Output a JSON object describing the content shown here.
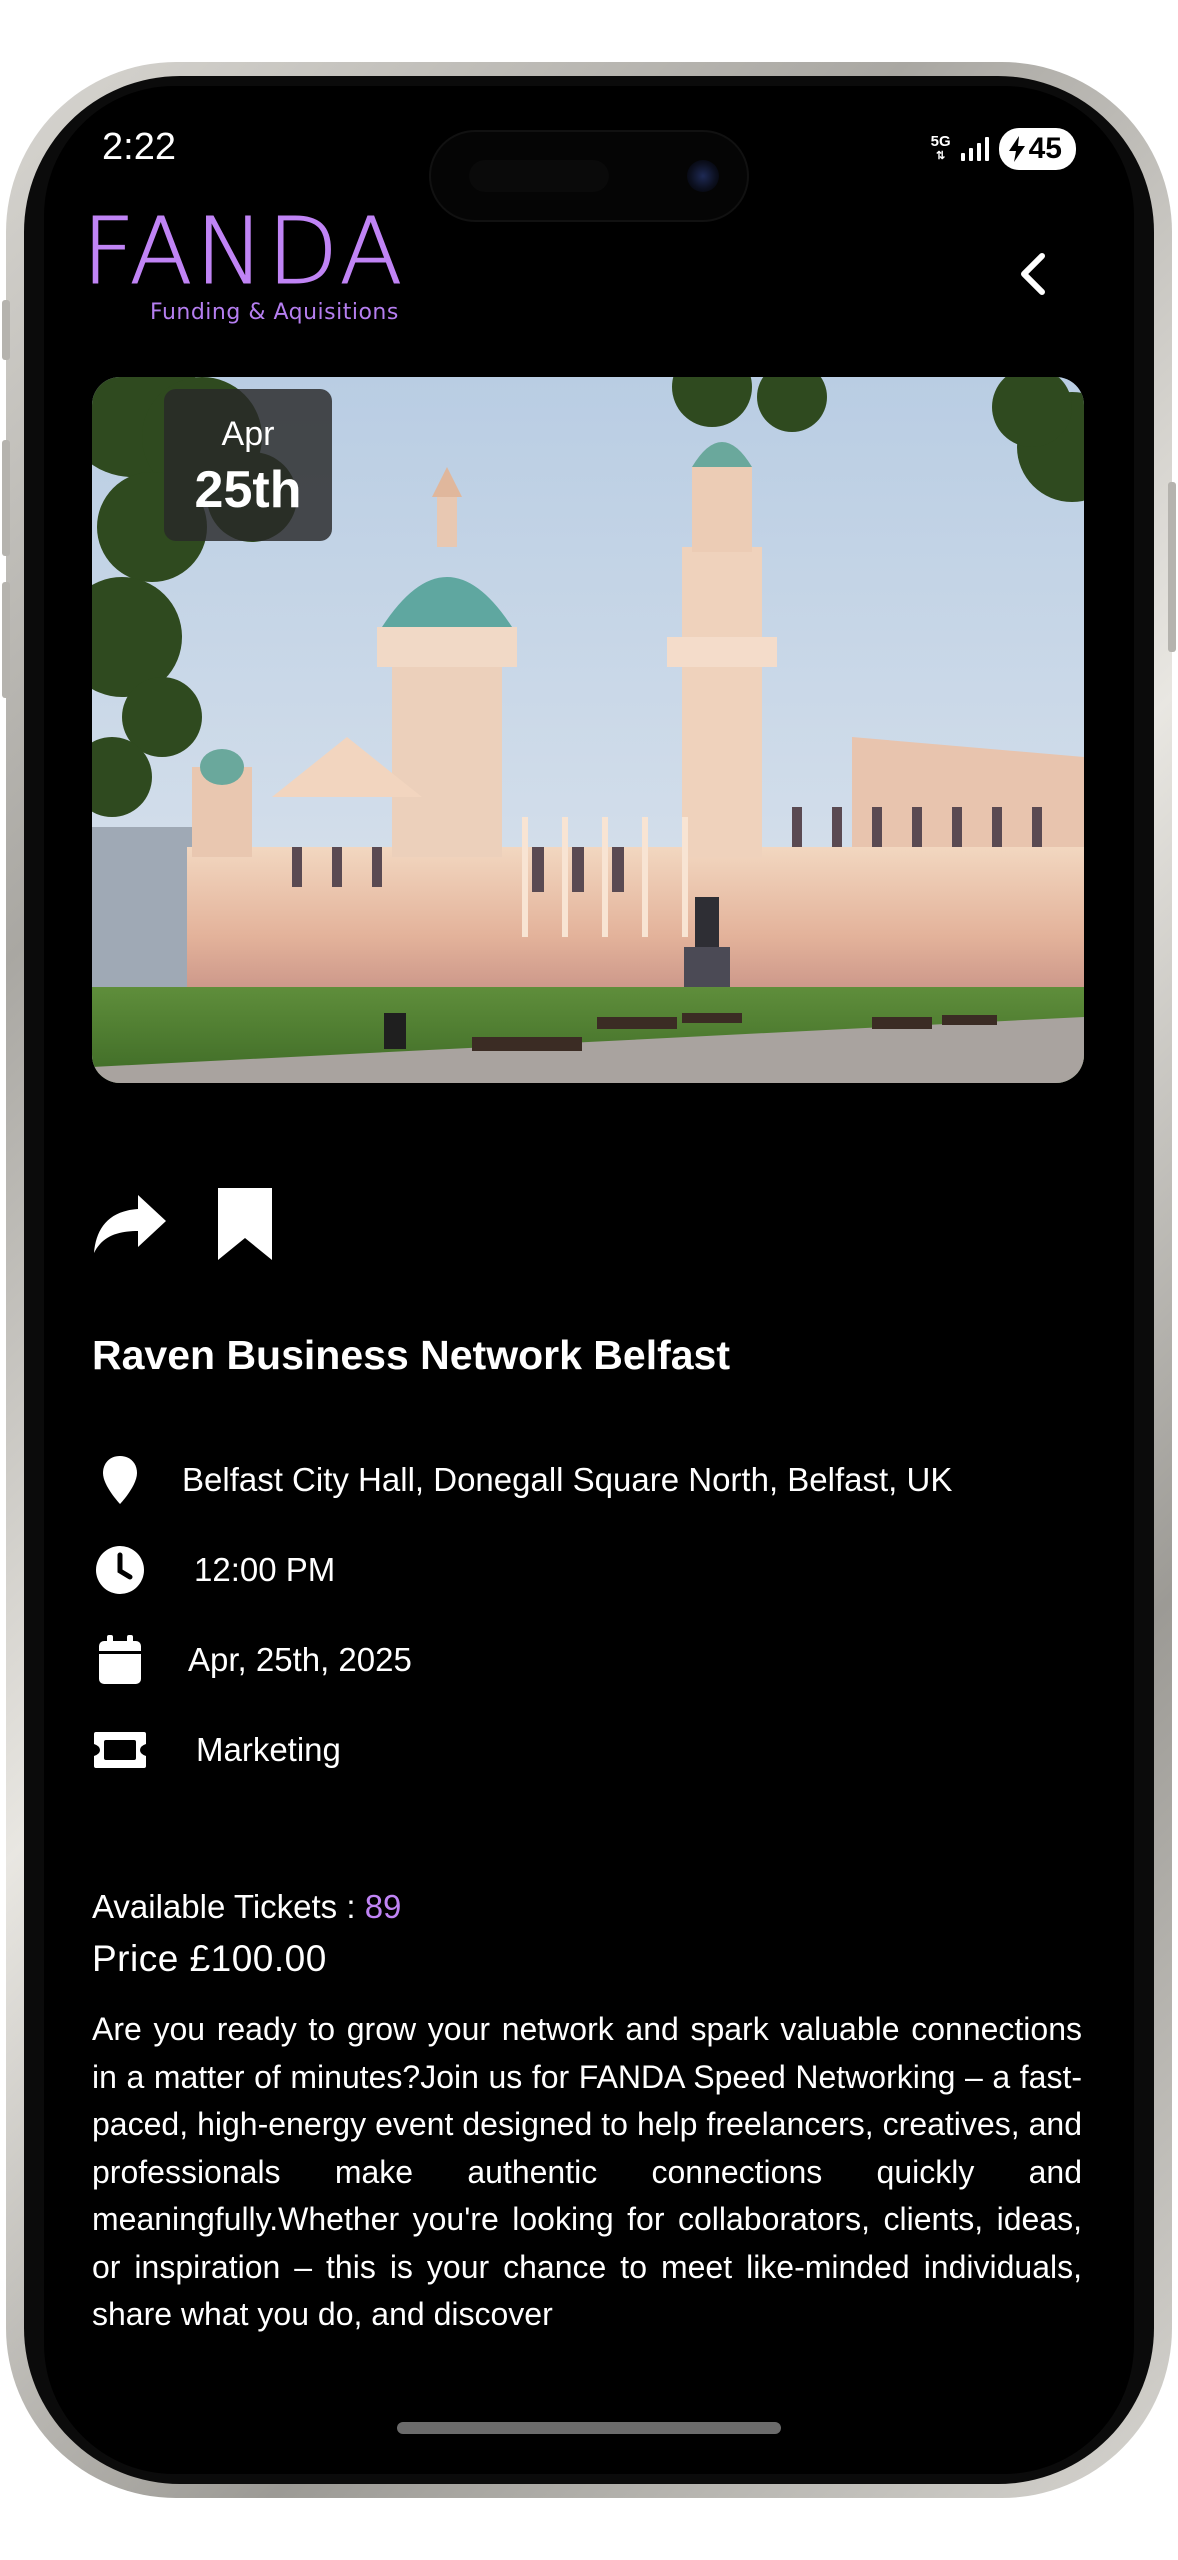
{
  "status_bar": {
    "time": "2:22",
    "network": "5G",
    "battery": "45"
  },
  "header": {
    "logo_title": "FANDA",
    "logo_subtitle": "Funding & Aquisitions",
    "back_icon": "chevron-left-icon"
  },
  "event": {
    "badge_month": "Apr",
    "badge_day": "25th",
    "image_subject": "Belfast City Hall",
    "title": "Raven Business Network Belfast",
    "location": "Belfast City Hall, Donegall Square North, Belfast, UK",
    "time": "12:00 PM",
    "date": "Apr, 25th, 2025",
    "category": "Marketing",
    "tickets_label": "Available Tickets : ",
    "tickets_count": "89",
    "price": "Price £100.00",
    "description": "Are you ready to grow your network and spark valuable connections in a matter of minutes?Join us for FANDA Speed Networking – a fast-paced, high-energy event designed to help freelancers, creatives, and professionals make authentic connections quickly and meaningfully.Whether you're looking for collaborators, clients, ideas, or inspiration – this is your chance to meet like-minded individuals, share what you do, and discover"
  },
  "icons": {
    "share": "share-icon",
    "bookmark": "bookmark-icon",
    "location": "location-pin-icon",
    "time": "clock-icon",
    "date": "calendar-icon",
    "category": "ticket-icon"
  },
  "colors": {
    "background": "#000000",
    "accent": "#c084f5",
    "text": "#ffffff"
  }
}
